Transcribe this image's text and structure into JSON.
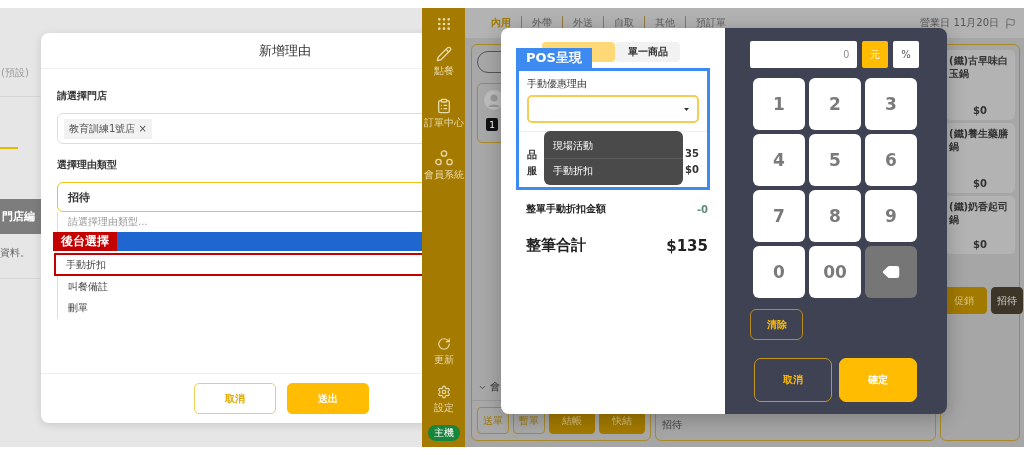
{
  "admin": {
    "background": {
      "column_label": "(預設)",
      "header_cell": "門店編",
      "note": "資料。"
    },
    "dialog": {
      "title": "新增理由",
      "store_label": "請選擇門店",
      "store_tags": [
        {
          "label": "教育訓練1號店",
          "remove": "×"
        }
      ],
      "type_label": "選擇理由類型",
      "type_value": "招待",
      "options": [
        {
          "kind": "placeholder",
          "label": "請選擇理由類型...",
          "annotated": false
        },
        {
          "kind": "hover",
          "annotated": false
        },
        {
          "kind": "option",
          "label": "手動折扣",
          "annotated": true
        },
        {
          "kind": "option",
          "label": "叫餐備註",
          "annotated": false
        },
        {
          "kind": "option",
          "label": "刪單",
          "annotated": false
        }
      ],
      "annotation": "後台選擇",
      "buttons": [
        {
          "label": "取消",
          "kind": "secondary"
        },
        {
          "label": "送出",
          "kind": "primary"
        }
      ]
    }
  },
  "pos": {
    "sidebar": {
      "items": [
        {
          "kind": "order",
          "label": "點餐"
        },
        {
          "kind": "orders",
          "label": "訂單中心"
        },
        {
          "kind": "members",
          "label": "會員系統"
        }
      ],
      "bottom_items": [
        {
          "kind": "refresh",
          "label": "更新"
        },
        {
          "kind": "settings",
          "label": "設定"
        }
      ],
      "host_badge": "主機"
    },
    "order_tabs": [
      {
        "label": "內用",
        "selected": true
      },
      {
        "label": "外帶",
        "selected": false
      },
      {
        "label": "外送",
        "selected": false
      },
      {
        "label": "自取",
        "selected": false
      },
      {
        "label": "其他",
        "selected": false
      },
      {
        "label": "預訂單",
        "selected": false
      }
    ],
    "business_day": "營業日",
    "date": "11月20日",
    "order_panel": {
      "item_count": "1",
      "section": "會",
      "buttons": [
        {
          "label": "送單",
          "kind": "outline"
        },
        {
          "label": "暫單",
          "kind": "outline"
        },
        {
          "label": "結帳",
          "kind": "filled"
        },
        {
          "label": "快結",
          "kind": "filled"
        }
      ]
    },
    "middle_panel": {
      "note": "招待"
    },
    "products": [
      {
        "name": "(鐵)古早味白玉鍋",
        "price": "$0"
      },
      {
        "name": "(鐵)養生藥膳鍋",
        "price": "$0"
      },
      {
        "name": "(鐵)奶香起司鍋",
        "price": "$0"
      }
    ],
    "product_buttons": [
      {
        "label": "促銷",
        "kind": "filled"
      },
      {
        "label": "招待",
        "kind": "dark"
      }
    ],
    "discount_dialog": {
      "tabs": [
        {
          "selected": true
        },
        {
          "label": "單一商品",
          "selected": false
        }
      ],
      "annotation": "POS呈現",
      "reason_label": "手動優惠理由",
      "reason_options": [
        "現場活動",
        "手動折扣"
      ],
      "summary": [
        {
          "label": "品",
          "value": "35"
        },
        {
          "label": "服",
          "value": "$0"
        }
      ],
      "discount_row": {
        "label": "整單手動折扣金額",
        "value": "-0"
      },
      "total": {
        "label": "整筆合計",
        "value": "$135"
      },
      "keypad": {
        "amount": "0",
        "units": [
          {
            "label": "元",
            "selected": true
          },
          {
            "label": "%",
            "selected": false
          }
        ],
        "keys": [
          {
            "kind": "digit",
            "label": "1"
          },
          {
            "kind": "digit",
            "label": "2"
          },
          {
            "kind": "digit",
            "label": "3"
          },
          {
            "kind": "digit",
            "label": "4"
          },
          {
            "kind": "digit",
            "label": "5"
          },
          {
            "kind": "digit",
            "label": "6"
          },
          {
            "kind": "digit",
            "label": "7"
          },
          {
            "kind": "digit",
            "label": "8"
          },
          {
            "kind": "digit",
            "label": "9"
          },
          {
            "kind": "digit",
            "label": "0"
          },
          {
            "kind": "digit",
            "label": "00"
          },
          {
            "kind": "backspace"
          }
        ],
        "clear": "清除",
        "buttons": [
          {
            "label": "取消",
            "kind": "secondary"
          },
          {
            "label": "確定",
            "kind": "primary"
          }
        ]
      }
    }
  }
}
